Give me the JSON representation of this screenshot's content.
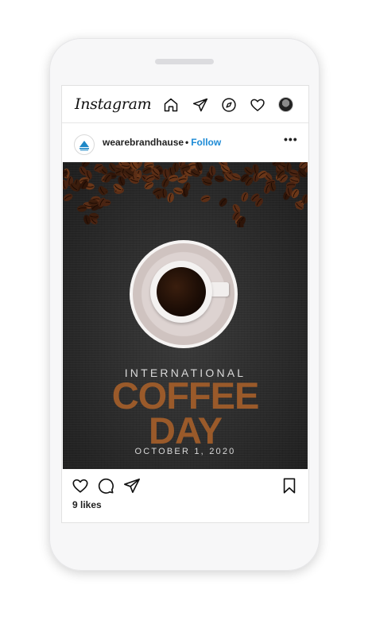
{
  "app": {
    "name": "Instagram"
  },
  "nav": {
    "icons": [
      "home-icon",
      "direct-icon",
      "explore-icon",
      "heart-icon",
      "profile-avatar"
    ]
  },
  "post": {
    "username": "wearebrandhause",
    "follow_label": "Follow",
    "follow_separator": "•",
    "more_label": "•••",
    "image": {
      "line1": "INTERNATIONAL",
      "line2": "COFFEE",
      "line3": "DAY",
      "date": "OCTOBER 1, 2020"
    },
    "likes": "9 likes"
  },
  "colors": {
    "accent_blue": "#1d8bd6",
    "coffee_brown": "#9a5a2a",
    "dark_bg": "#262626"
  }
}
